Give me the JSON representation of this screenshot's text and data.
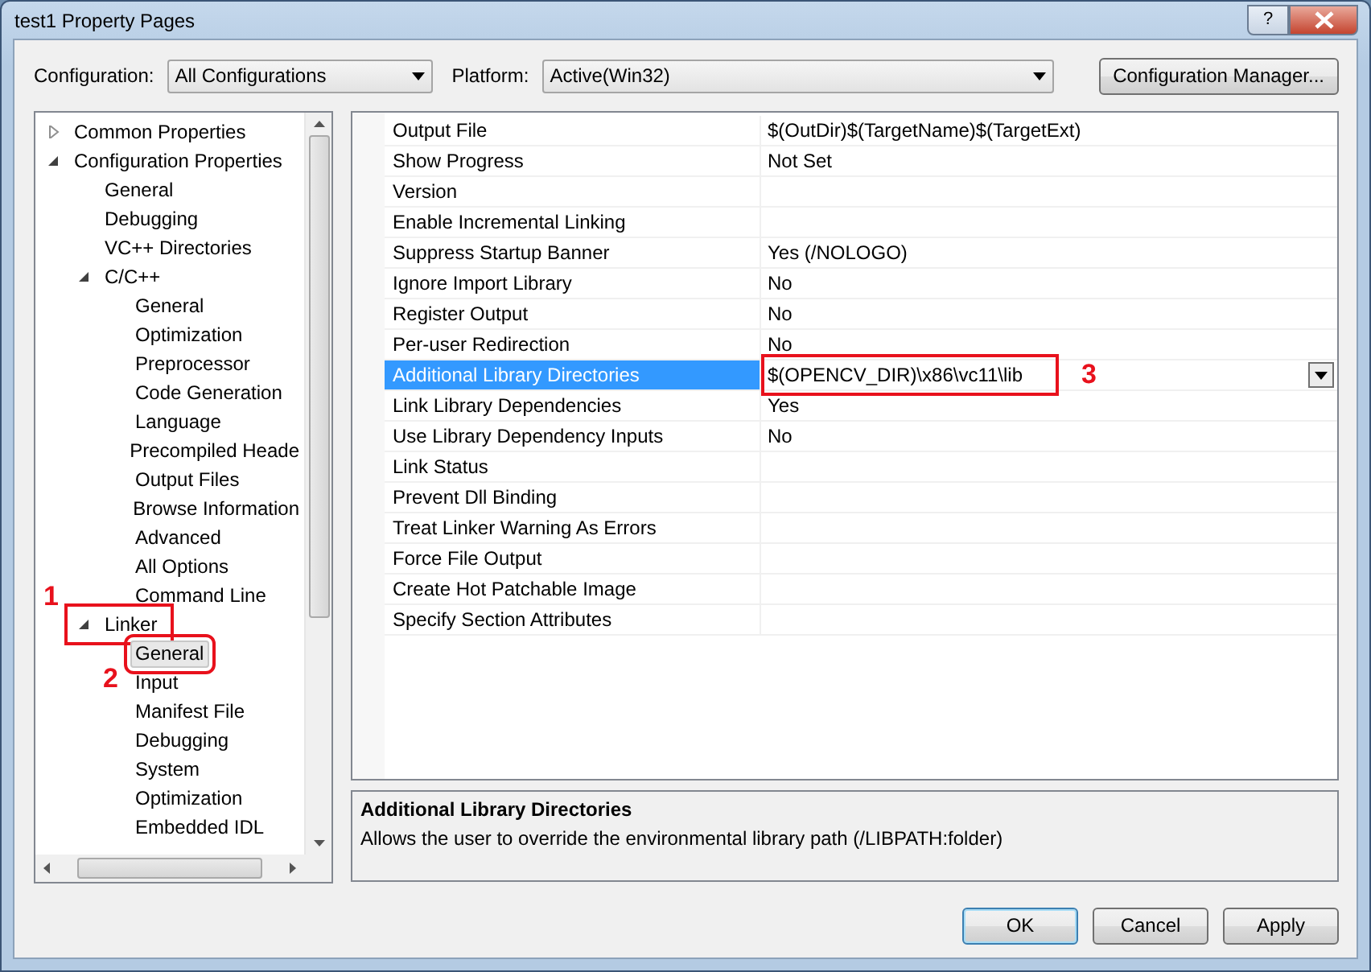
{
  "window": {
    "title": "test1 Property Pages",
    "help_button": "?"
  },
  "toolbar": {
    "configuration": {
      "label": "Configuration:",
      "value": "All Configurations"
    },
    "platform": {
      "label": "Platform:",
      "value": "Active(Win32)"
    },
    "manager_button": "Configuration Manager..."
  },
  "tree": [
    {
      "label": "Common Properties",
      "expanded": false,
      "selected": false
    },
    {
      "label": "Configuration Properties",
      "expanded": true,
      "selected": false,
      "children": [
        {
          "label": "General",
          "selected": false
        },
        {
          "label": "Debugging",
          "selected": false
        },
        {
          "label": "VC++ Directories",
          "selected": false
        },
        {
          "label": "C/C++",
          "expanded": true,
          "selected": false,
          "children": [
            {
              "label": "General",
              "selected": false
            },
            {
              "label": "Optimization",
              "selected": false
            },
            {
              "label": "Preprocessor",
              "selected": false
            },
            {
              "label": "Code Generation",
              "selected": false
            },
            {
              "label": "Language",
              "selected": false
            },
            {
              "label": "Precompiled Heade",
              "selected": false
            },
            {
              "label": "Output Files",
              "selected": false
            },
            {
              "label": "Browse Information",
              "selected": false
            },
            {
              "label": "Advanced",
              "selected": false
            },
            {
              "label": "All Options",
              "selected": false
            },
            {
              "label": "Command Line",
              "selected": false
            }
          ]
        },
        {
          "label": "Linker",
          "expanded": true,
          "selected": false,
          "marker": "1",
          "children": [
            {
              "label": "General",
              "selected": true,
              "marker": "2"
            },
            {
              "label": "Input",
              "selected": false
            },
            {
              "label": "Manifest File",
              "selected": false
            },
            {
              "label": "Debugging",
              "selected": false
            },
            {
              "label": "System",
              "selected": false
            },
            {
              "label": "Optimization",
              "selected": false
            },
            {
              "label": "Embedded IDL",
              "selected": false
            }
          ]
        }
      ]
    }
  ],
  "properties": [
    {
      "name": "Output File",
      "value": "$(OutDir)$(TargetName)$(TargetExt)",
      "selected": false
    },
    {
      "name": "Show Progress",
      "value": "Not Set",
      "selected": false
    },
    {
      "name": "Version",
      "selected": false
    },
    {
      "name": "Enable Incremental Linking",
      "selected": false
    },
    {
      "name": "Suppress Startup Banner",
      "value": "Yes (/NOLOGO)",
      "selected": false
    },
    {
      "name": "Ignore Import Library",
      "value": "No",
      "selected": false
    },
    {
      "name": "Register Output",
      "value": "No",
      "selected": false
    },
    {
      "name": "Per-user Redirection",
      "value": "No",
      "selected": false
    },
    {
      "name": "Additional Library Directories",
      "value": "$(OPENCV_DIR)\\x86\\vc11\\lib",
      "selected": true,
      "marker": "3"
    },
    {
      "name": "Link Library Dependencies",
      "value": "Yes",
      "selected": false
    },
    {
      "name": "Use Library Dependency Inputs",
      "value": "No",
      "selected": false
    },
    {
      "name": "Link Status",
      "selected": false
    },
    {
      "name": "Prevent Dll Binding",
      "selected": false
    },
    {
      "name": "Treat Linker Warning As Errors",
      "selected": false
    },
    {
      "name": "Force File Output",
      "selected": false
    },
    {
      "name": "Create Hot Patchable Image",
      "selected": false
    },
    {
      "name": "Specify Section Attributes",
      "selected": false
    }
  ],
  "description": {
    "title": "Additional Library Directories",
    "text": "Allows the user to override the environmental library path (/LIBPATH:folder)"
  },
  "buttons": [
    {
      "label": "OK",
      "kind": "default"
    },
    {
      "label": "Cancel",
      "kind": "normal"
    },
    {
      "label": "Apply",
      "kind": "normal"
    }
  ]
}
